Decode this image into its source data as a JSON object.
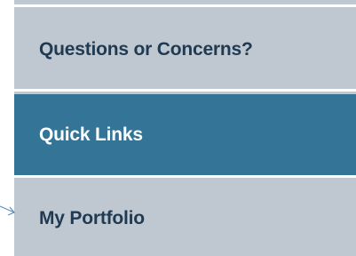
{
  "menu": {
    "items": [
      {
        "label": "Questions or Concerns?",
        "active": false
      },
      {
        "label": "Quick Links",
        "active": true
      },
      {
        "label": "My Portfolio",
        "active": false
      }
    ]
  },
  "colors": {
    "item_background": "#bfc8d1",
    "active_background": "#347597",
    "item_text": "#1f3a52",
    "active_text": "#ffffff",
    "divider": "#ffffff",
    "arrow": "#5a8ec4"
  },
  "icons": {
    "pointer": "arrow-pointer-icon"
  }
}
